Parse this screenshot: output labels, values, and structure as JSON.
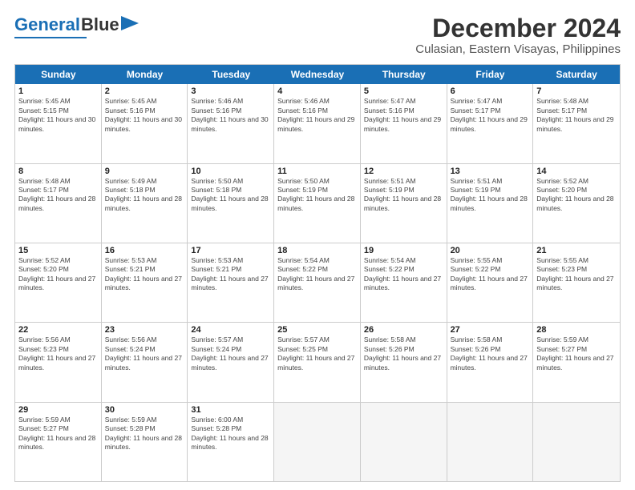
{
  "logo": {
    "line1": "General",
    "line2": "Blue"
  },
  "title": "December 2024",
  "subtitle": "Culasian, Eastern Visayas, Philippines",
  "header": {
    "days": [
      "Sunday",
      "Monday",
      "Tuesday",
      "Wednesday",
      "Thursday",
      "Friday",
      "Saturday"
    ]
  },
  "weeks": [
    [
      {
        "day": "1",
        "rise": "Sunrise: 5:45 AM",
        "set": "Sunset: 5:15 PM",
        "daylight": "Daylight: 11 hours and 30 minutes."
      },
      {
        "day": "2",
        "rise": "Sunrise: 5:45 AM",
        "set": "Sunset: 5:16 PM",
        "daylight": "Daylight: 11 hours and 30 minutes."
      },
      {
        "day": "3",
        "rise": "Sunrise: 5:46 AM",
        "set": "Sunset: 5:16 PM",
        "daylight": "Daylight: 11 hours and 30 minutes."
      },
      {
        "day": "4",
        "rise": "Sunrise: 5:46 AM",
        "set": "Sunset: 5:16 PM",
        "daylight": "Daylight: 11 hours and 29 minutes."
      },
      {
        "day": "5",
        "rise": "Sunrise: 5:47 AM",
        "set": "Sunset: 5:16 PM",
        "daylight": "Daylight: 11 hours and 29 minutes."
      },
      {
        "day": "6",
        "rise": "Sunrise: 5:47 AM",
        "set": "Sunset: 5:17 PM",
        "daylight": "Daylight: 11 hours and 29 minutes."
      },
      {
        "day": "7",
        "rise": "Sunrise: 5:48 AM",
        "set": "Sunset: 5:17 PM",
        "daylight": "Daylight: 11 hours and 29 minutes."
      }
    ],
    [
      {
        "day": "8",
        "rise": "Sunrise: 5:48 AM",
        "set": "Sunset: 5:17 PM",
        "daylight": "Daylight: 11 hours and 28 minutes."
      },
      {
        "day": "9",
        "rise": "Sunrise: 5:49 AM",
        "set": "Sunset: 5:18 PM",
        "daylight": "Daylight: 11 hours and 28 minutes."
      },
      {
        "day": "10",
        "rise": "Sunrise: 5:50 AM",
        "set": "Sunset: 5:18 PM",
        "daylight": "Daylight: 11 hours and 28 minutes."
      },
      {
        "day": "11",
        "rise": "Sunrise: 5:50 AM",
        "set": "Sunset: 5:19 PM",
        "daylight": "Daylight: 11 hours and 28 minutes."
      },
      {
        "day": "12",
        "rise": "Sunrise: 5:51 AM",
        "set": "Sunset: 5:19 PM",
        "daylight": "Daylight: 11 hours and 28 minutes."
      },
      {
        "day": "13",
        "rise": "Sunrise: 5:51 AM",
        "set": "Sunset: 5:19 PM",
        "daylight": "Daylight: 11 hours and 28 minutes."
      },
      {
        "day": "14",
        "rise": "Sunrise: 5:52 AM",
        "set": "Sunset: 5:20 PM",
        "daylight": "Daylight: 11 hours and 28 minutes."
      }
    ],
    [
      {
        "day": "15",
        "rise": "Sunrise: 5:52 AM",
        "set": "Sunset: 5:20 PM",
        "daylight": "Daylight: 11 hours and 27 minutes."
      },
      {
        "day": "16",
        "rise": "Sunrise: 5:53 AM",
        "set": "Sunset: 5:21 PM",
        "daylight": "Daylight: 11 hours and 27 minutes."
      },
      {
        "day": "17",
        "rise": "Sunrise: 5:53 AM",
        "set": "Sunset: 5:21 PM",
        "daylight": "Daylight: 11 hours and 27 minutes."
      },
      {
        "day": "18",
        "rise": "Sunrise: 5:54 AM",
        "set": "Sunset: 5:22 PM",
        "daylight": "Daylight: 11 hours and 27 minutes."
      },
      {
        "day": "19",
        "rise": "Sunrise: 5:54 AM",
        "set": "Sunset: 5:22 PM",
        "daylight": "Daylight: 11 hours and 27 minutes."
      },
      {
        "day": "20",
        "rise": "Sunrise: 5:55 AM",
        "set": "Sunset: 5:22 PM",
        "daylight": "Daylight: 11 hours and 27 minutes."
      },
      {
        "day": "21",
        "rise": "Sunrise: 5:55 AM",
        "set": "Sunset: 5:23 PM",
        "daylight": "Daylight: 11 hours and 27 minutes."
      }
    ],
    [
      {
        "day": "22",
        "rise": "Sunrise: 5:56 AM",
        "set": "Sunset: 5:23 PM",
        "daylight": "Daylight: 11 hours and 27 minutes."
      },
      {
        "day": "23",
        "rise": "Sunrise: 5:56 AM",
        "set": "Sunset: 5:24 PM",
        "daylight": "Daylight: 11 hours and 27 minutes."
      },
      {
        "day": "24",
        "rise": "Sunrise: 5:57 AM",
        "set": "Sunset: 5:24 PM",
        "daylight": "Daylight: 11 hours and 27 minutes."
      },
      {
        "day": "25",
        "rise": "Sunrise: 5:57 AM",
        "set": "Sunset: 5:25 PM",
        "daylight": "Daylight: 11 hours and 27 minutes."
      },
      {
        "day": "26",
        "rise": "Sunrise: 5:58 AM",
        "set": "Sunset: 5:26 PM",
        "daylight": "Daylight: 11 hours and 27 minutes."
      },
      {
        "day": "27",
        "rise": "Sunrise: 5:58 AM",
        "set": "Sunset: 5:26 PM",
        "daylight": "Daylight: 11 hours and 27 minutes."
      },
      {
        "day": "28",
        "rise": "Sunrise: 5:59 AM",
        "set": "Sunset: 5:27 PM",
        "daylight": "Daylight: 11 hours and 27 minutes."
      }
    ],
    [
      {
        "day": "29",
        "rise": "Sunrise: 5:59 AM",
        "set": "Sunset: 5:27 PM",
        "daylight": "Daylight: 11 hours and 28 minutes."
      },
      {
        "day": "30",
        "rise": "Sunrise: 5:59 AM",
        "set": "Sunset: 5:28 PM",
        "daylight": "Daylight: 11 hours and 28 minutes."
      },
      {
        "day": "31",
        "rise": "Sunrise: 6:00 AM",
        "set": "Sunset: 5:28 PM",
        "daylight": "Daylight: 11 hours and 28 minutes."
      },
      {
        "day": "",
        "rise": "",
        "set": "",
        "daylight": ""
      },
      {
        "day": "",
        "rise": "",
        "set": "",
        "daylight": ""
      },
      {
        "day": "",
        "rise": "",
        "set": "",
        "daylight": ""
      },
      {
        "day": "",
        "rise": "",
        "set": "",
        "daylight": ""
      }
    ]
  ]
}
